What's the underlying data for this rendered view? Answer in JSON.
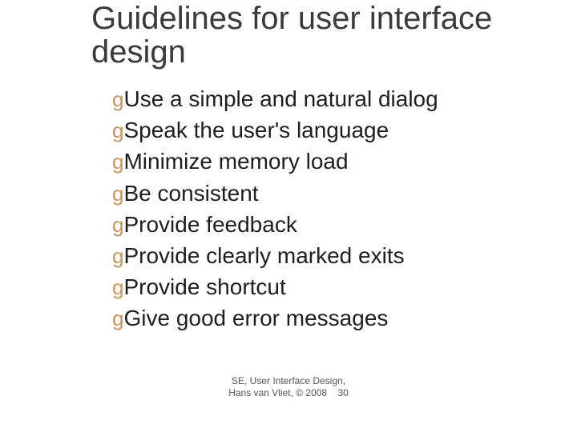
{
  "title": "Guidelines for user interface design",
  "bullet_glyph": "g",
  "items": [
    "Use a simple and natural dialog",
    "Speak the user's language",
    "Minimize memory load",
    "Be consistent",
    "Provide feedback",
    "Provide clearly marked exits",
    "Provide shortcut",
    "Give good error messages"
  ],
  "footer": {
    "line1": "SE, User Interface Design,",
    "line2": "Hans van Vliet, © 2008",
    "page_number": "30"
  }
}
